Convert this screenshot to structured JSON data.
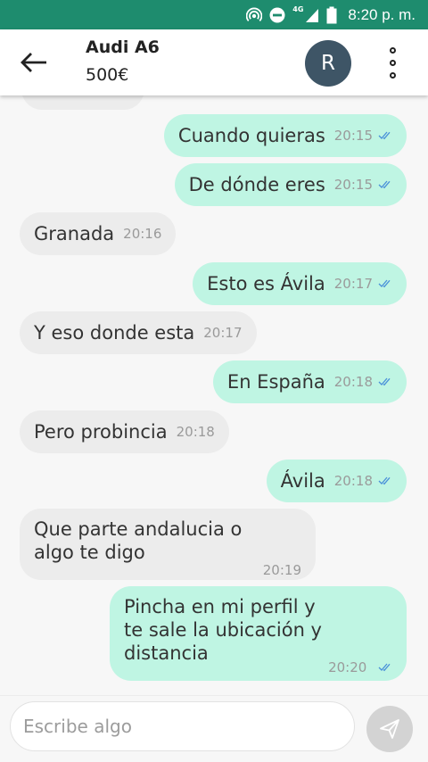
{
  "status_bar": {
    "time": "8:20 p. m.",
    "network": "4G",
    "icons": [
      "hotspot-icon",
      "do-not-disturb-icon",
      "signal-icon",
      "battery-icon"
    ]
  },
  "header": {
    "title": "Audi A6",
    "subtitle": "500€",
    "avatar_letter": "R",
    "avatar_color": "#3e5566"
  },
  "messages": [
    {
      "dir": "out",
      "text": "Cuando quieras",
      "time": "20:15",
      "read": true
    },
    {
      "dir": "out",
      "text": "De dónde eres",
      "time": "20:15",
      "read": true
    },
    {
      "dir": "in",
      "text": "Granada",
      "time": "20:16"
    },
    {
      "dir": "out",
      "text": "Esto es Ávila",
      "time": "20:17",
      "read": true
    },
    {
      "dir": "in",
      "text": "Y eso donde esta",
      "time": "20:17"
    },
    {
      "dir": "out",
      "text": "En España",
      "time": "20:18",
      "read": true
    },
    {
      "dir": "in",
      "text": "Pero probincia",
      "time": "20:18"
    },
    {
      "dir": "out",
      "text": "Ávila",
      "time": "20:18",
      "read": true
    },
    {
      "dir": "in",
      "text": "Que parte andalucia o\nalgo te digo",
      "time": "20:19"
    },
    {
      "dir": "out",
      "text": "Pincha en mi perfil y\nte sale la ubicación y\ndistancia",
      "time": "20:20",
      "read": true
    }
  ],
  "composer": {
    "placeholder": "Escribe algo"
  },
  "colors": {
    "accent": "#1e8c6e",
    "outgoing_bubble": "#bff5e3",
    "incoming_bubble": "#ececec",
    "read_check": "#4a90d9"
  }
}
